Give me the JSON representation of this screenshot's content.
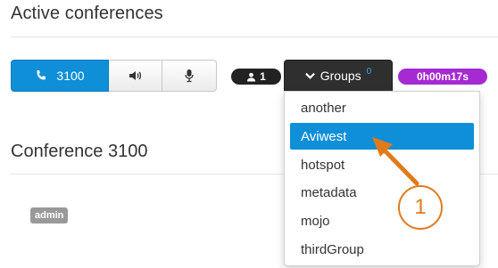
{
  "header": {
    "title": "Active conferences"
  },
  "conference_controls": {
    "call_label": "3100",
    "users_count": "1",
    "groups_label": "Groups",
    "groups_count": "0",
    "timer": "0h00m17s"
  },
  "groups_dropdown": {
    "items": [
      "another",
      "Aviwest",
      "hotspot",
      "metadata",
      "mojo",
      "thirdGroup"
    ],
    "active_item": "Aviwest"
  },
  "conference_section": {
    "title": "Conference 3100",
    "member_tag": "admin"
  },
  "annotation": {
    "number": "1"
  },
  "colors": {
    "primary": "#0e8fd8",
    "timer_badge": "#a52ad2",
    "annotation": "#e07b1c",
    "dark_button": "#2f2f2f"
  },
  "icons": [
    "phone-icon",
    "speaker-icon",
    "microphone-icon",
    "user-icon",
    "chevron-down-icon"
  ]
}
